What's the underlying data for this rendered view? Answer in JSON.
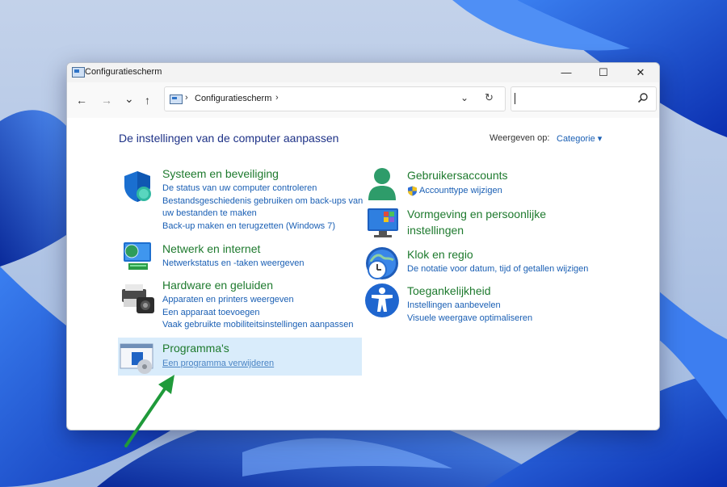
{
  "window": {
    "title": "Configuratiescherm",
    "buttons": {
      "minimize": "—",
      "maximize": "☐",
      "close": "✕"
    }
  },
  "toolbar": {
    "back": "←",
    "forward": "→",
    "recent": "⌄",
    "up": "↑",
    "address": "Configuratiescherm",
    "address_sep": "›",
    "address_chevron": "⌄",
    "refresh": "↻"
  },
  "page": {
    "heading": "De instellingen van de computer aanpassen",
    "view_by_label": "Weergeven op:",
    "view_by_value": "Categorie ▾"
  },
  "categories": [
    {
      "title": "Systeem en beveiliging",
      "icon": "shield-icon",
      "links": [
        "De status van uw computer controleren",
        "Bestandsgeschiedenis gebruiken om back-ups van",
        "uw bestanden te maken",
        "Back-up maken en terugzetten (Windows 7)"
      ]
    },
    {
      "title": "Netwerk en internet",
      "icon": "network-icon",
      "links": [
        "Netwerkstatus en -taken weergeven"
      ]
    },
    {
      "title": "Hardware en geluiden",
      "icon": "printer-icon",
      "links": [
        "Apparaten en printers weergeven",
        "Een apparaat toevoegen",
        "Vaak gebruikte mobiliteitsinstellingen aanpassen"
      ]
    },
    {
      "title": "Programma's",
      "icon": "programs-icon",
      "links": [
        "Een programma verwijderen"
      ]
    },
    {
      "title": "Gebruikersaccounts",
      "icon": "user-icon",
      "links": [
        "Accounttype wijzigen"
      ]
    },
    {
      "title_line1": "Vormgeving en persoonlijke",
      "title_line2": "instellingen",
      "icon": "appearance-icon",
      "links": []
    },
    {
      "title": "Klok en regio",
      "icon": "clock-icon",
      "links": [
        "De notatie voor datum, tijd of getallen wijzigen"
      ]
    },
    {
      "title": "Toegankelijkheid",
      "icon": "accessibility-icon",
      "links": [
        "Instellingen aanbevelen",
        "Visuele weergave optimaliseren"
      ]
    }
  ],
  "colors": {
    "title_green": "#1e7a2e",
    "link_blue": "#1a5fb4",
    "heading_navy": "#1e3287",
    "highlight": "#d9ecfb",
    "arrow": "#1f9a3a"
  }
}
